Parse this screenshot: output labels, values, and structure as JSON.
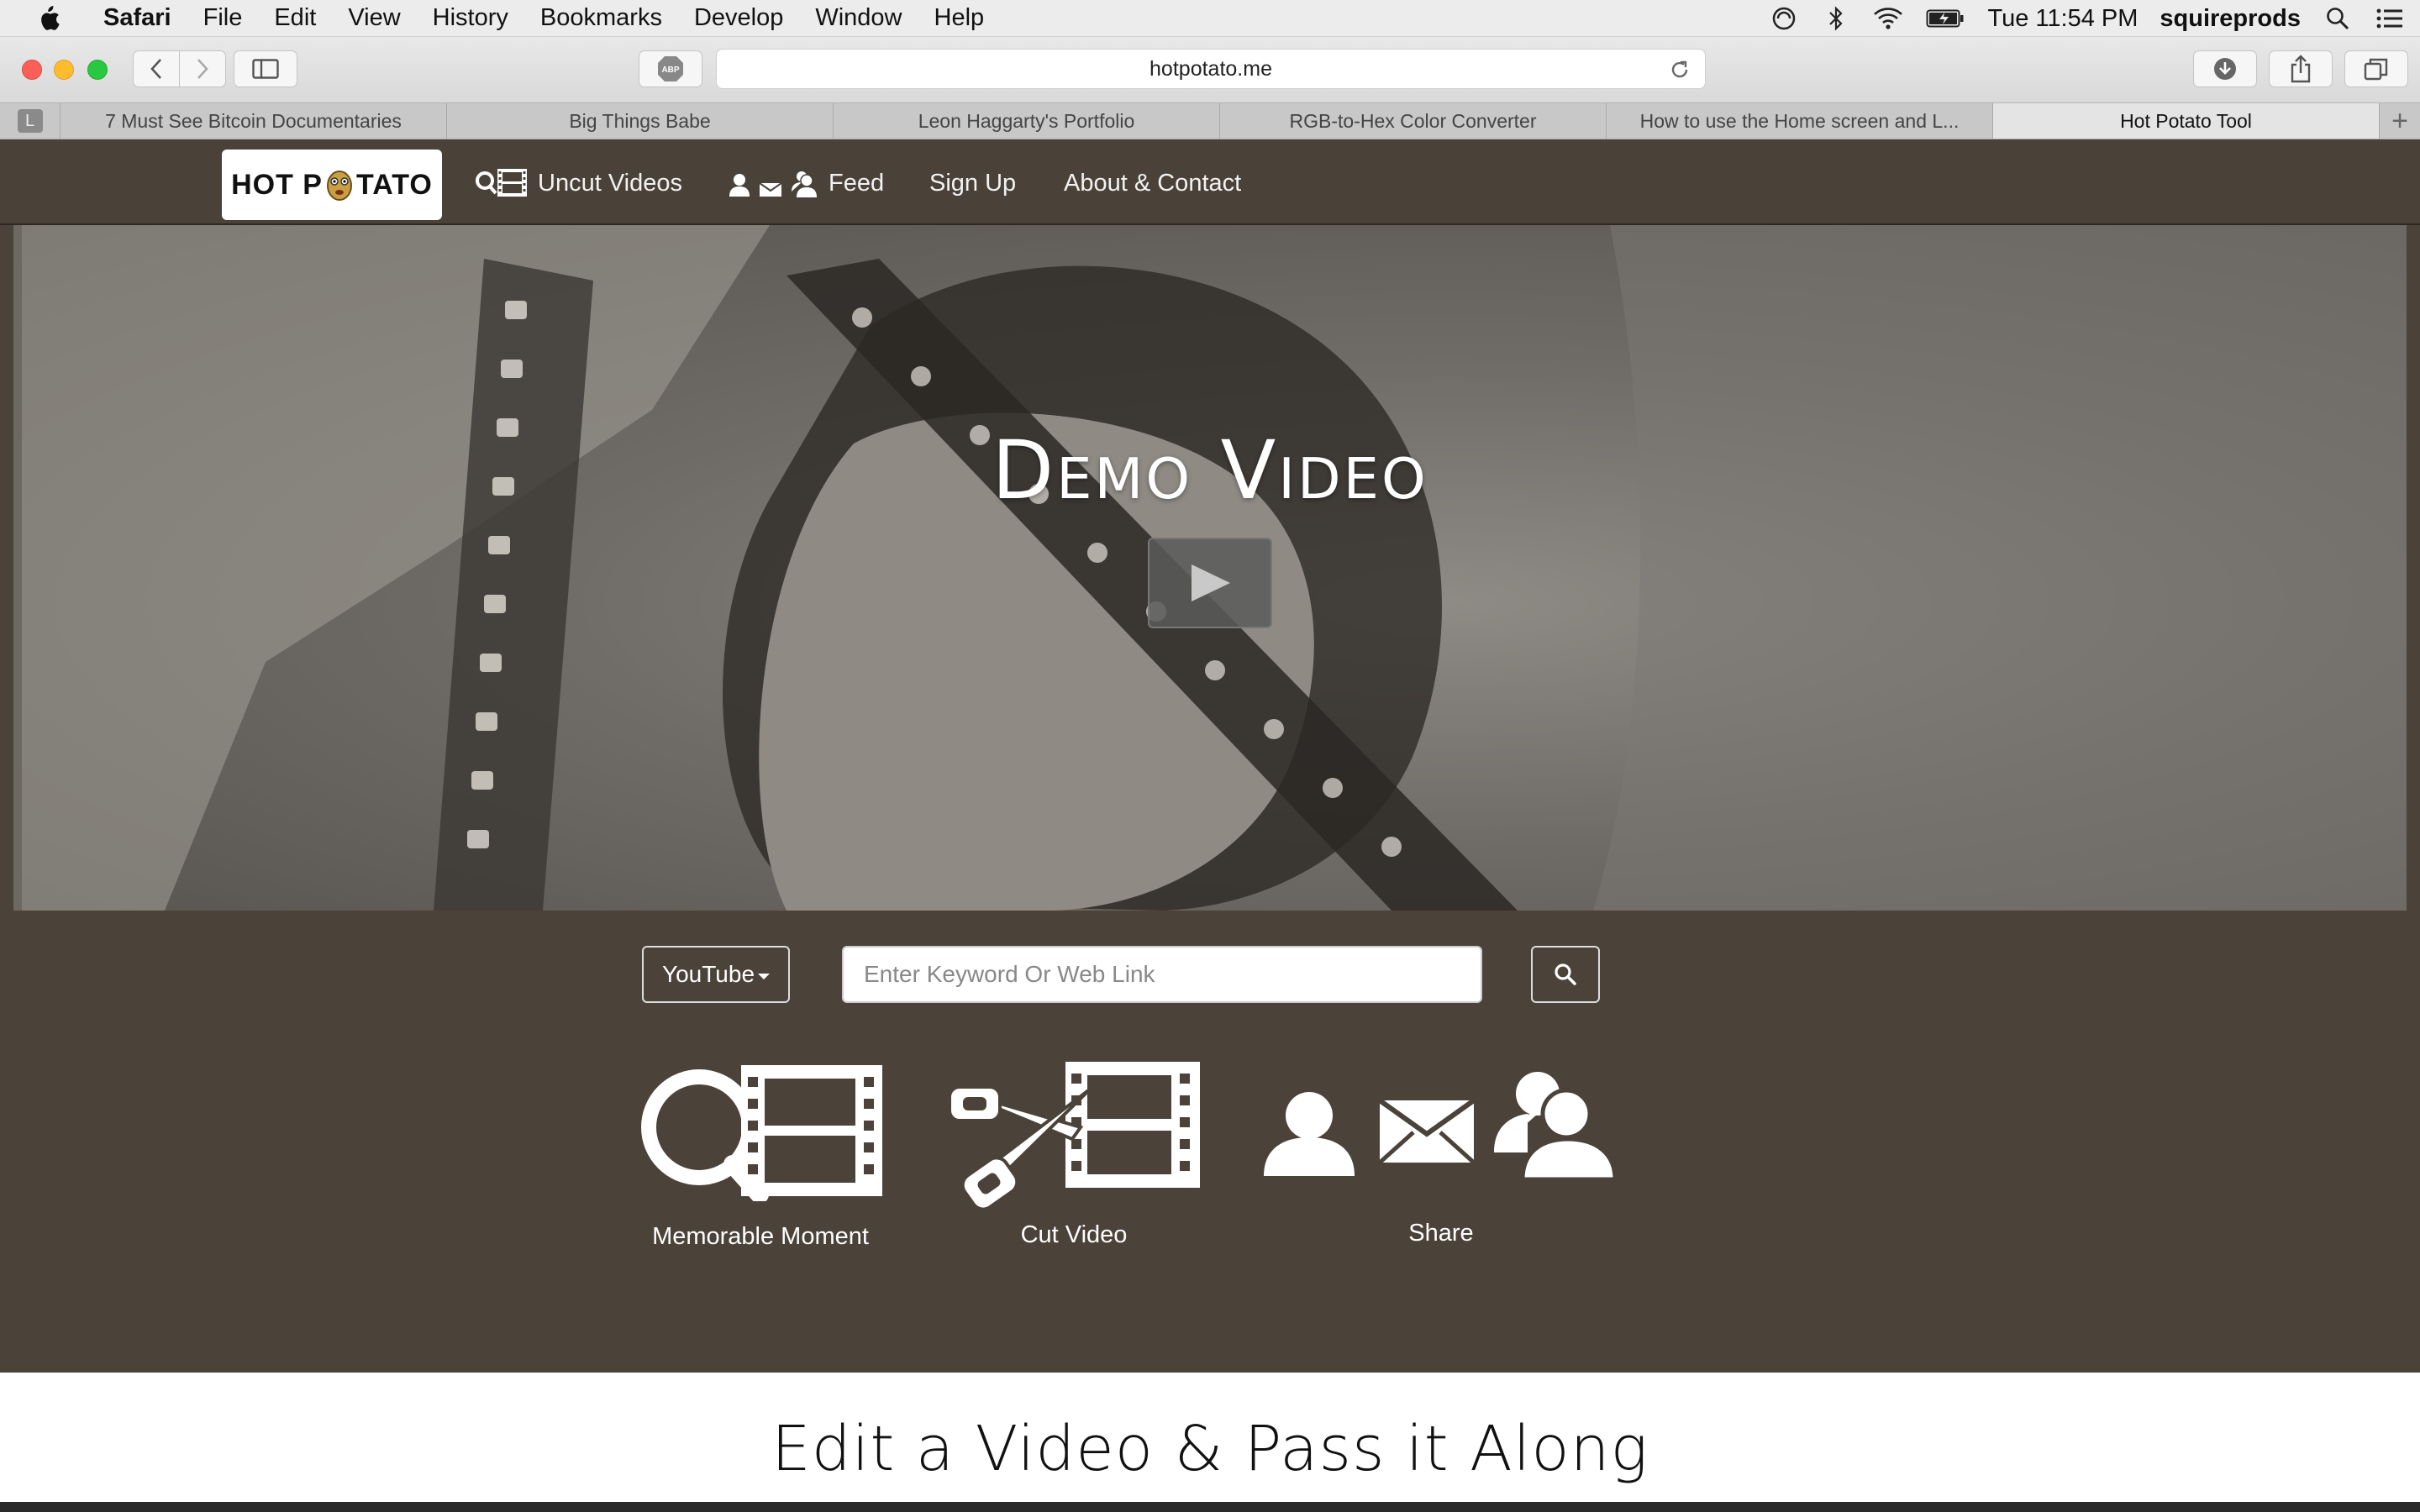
{
  "menubar": {
    "app_name": "Safari",
    "items": [
      "File",
      "Edit",
      "View",
      "History",
      "Bookmarks",
      "Develop",
      "Window",
      "Help"
    ],
    "clock": "Tue 11:54 PM",
    "user": "squireprods"
  },
  "browser": {
    "url": "hotpotato.me",
    "pinned_tab_letter": "L",
    "tabs": [
      "7 Must See Bitcoin Documentaries",
      "Big Things Babe",
      "Leon Haggarty's Portfolio",
      "RGB-to-Hex Color Converter",
      "How to use the Home screen and L...",
      "Hot Potato Tool"
    ],
    "active_tab_index": 5,
    "new_tab_symbol": "+"
  },
  "site": {
    "logo_left": "HOT P",
    "logo_right": "TATO",
    "nav": {
      "uncut_videos": "Uncut Videos",
      "feed": "Feed",
      "sign_up": "Sign Up",
      "about": "About & Contact"
    },
    "hero_title": "Demo Video",
    "search": {
      "source": "YouTube",
      "placeholder": "Enter Keyword Or Web Link"
    },
    "features": {
      "memorable": "Memorable Moment",
      "cut": "Cut Video",
      "share": "Share"
    },
    "tagline": "Edit a Video & Pass it Along"
  },
  "colors": {
    "nav_bg": "#4a4239",
    "page_bg": "#4b4239",
    "bottom_band": "#ffffff"
  }
}
